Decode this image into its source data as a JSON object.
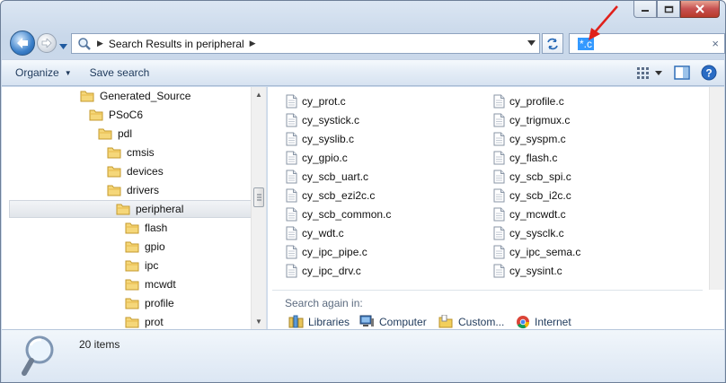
{
  "window": {
    "address_path": "Search Results in peripheral",
    "search_query": "*.c",
    "search_clear_glyph": "×",
    "colors": {
      "selection_blue": "#3399ff",
      "annotation_red": "#e0201b",
      "close_red": "#c75050"
    }
  },
  "toolbar": {
    "organize_label": "Organize",
    "save_search_label": "Save search",
    "view_icon": "view-options-icon",
    "preview_icon": "preview-pane-icon",
    "help_icon": "help-icon"
  },
  "tree": {
    "items": [
      {
        "label": "Generated_Source"
      },
      {
        "label": "PSoC6"
      },
      {
        "label": "pdl"
      },
      {
        "label": "cmsis"
      },
      {
        "label": "devices"
      },
      {
        "label": "drivers"
      },
      {
        "label": "peripheral",
        "selected": true
      },
      {
        "label": "flash"
      },
      {
        "label": "gpio"
      },
      {
        "label": "ipc"
      },
      {
        "label": "mcwdt"
      },
      {
        "label": "profile"
      },
      {
        "label": "prot"
      }
    ]
  },
  "files": {
    "left": [
      "cy_prot.c",
      "cy_systick.c",
      "cy_syslib.c",
      "cy_gpio.c",
      "cy_scb_uart.c",
      "cy_scb_ezi2c.c",
      "cy_scb_common.c",
      "cy_wdt.c",
      "cy_ipc_pipe.c",
      "cy_ipc_drv.c"
    ],
    "right": [
      "cy_profile.c",
      "cy_trigmux.c",
      "cy_syspm.c",
      "cy_flash.c",
      "cy_scb_spi.c",
      "cy_scb_i2c.c",
      "cy_mcwdt.c",
      "cy_sysclk.c",
      "cy_ipc_sema.c",
      "cy_sysint.c"
    ]
  },
  "search_again": {
    "label": "Search again in:",
    "locations": [
      "Libraries",
      "Computer",
      "Custom...",
      "Internet"
    ]
  },
  "details": {
    "item_count": "20 items"
  }
}
